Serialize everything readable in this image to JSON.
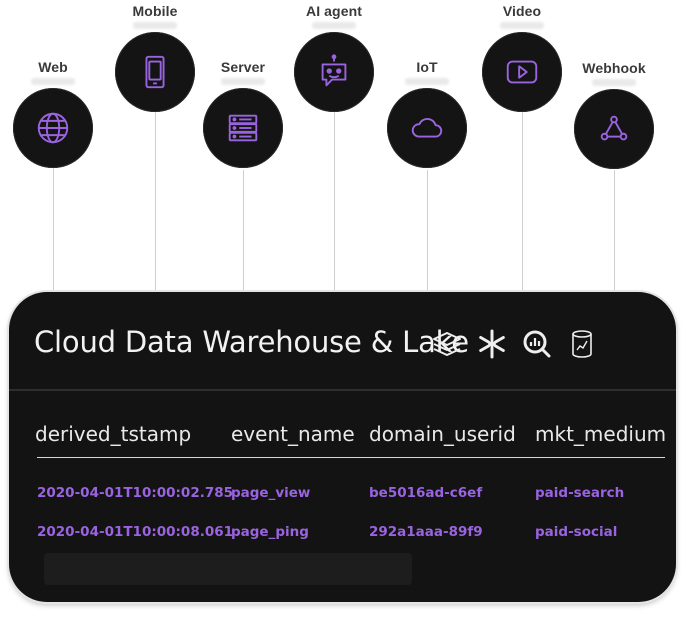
{
  "sources": [
    {
      "id": "web",
      "label": "Web",
      "icon": "globe-icon"
    },
    {
      "id": "mobile",
      "label": "Mobile",
      "icon": "mobile-phone-icon"
    },
    {
      "id": "server",
      "label": "Server",
      "icon": "server-icon"
    },
    {
      "id": "ai-agent",
      "label": "AI agent",
      "icon": "robot-icon"
    },
    {
      "id": "iot",
      "label": "IoT",
      "icon": "cloud-icon"
    },
    {
      "id": "video",
      "label": "Video",
      "icon": "video-play-icon"
    },
    {
      "id": "webhook",
      "label": "Webhook",
      "icon": "webhook-icon"
    }
  ],
  "warehouse": {
    "title": "Cloud Data Warehouse & Lake",
    "logos": [
      "layers-logo-icon",
      "snowflake-logo-icon",
      "bigquery-logo-icon",
      "database-lake-logo-icon"
    ],
    "table": {
      "columns": [
        "derived_tstamp",
        "event_name",
        "domain_userid",
        "mkt_medium"
      ],
      "rows": [
        [
          "2020-04-01T10:00:02.785",
          "page_view",
          "be5016ad-c6ef",
          "paid-search"
        ],
        [
          "2020-04-01T10:00:08.061",
          "page_ping",
          "292a1aaa-89f9",
          "paid-social"
        ]
      ]
    }
  },
  "colors": {
    "accent": "#9a63e0",
    "node_bg": "#141414",
    "panel_bg": "#131313"
  }
}
